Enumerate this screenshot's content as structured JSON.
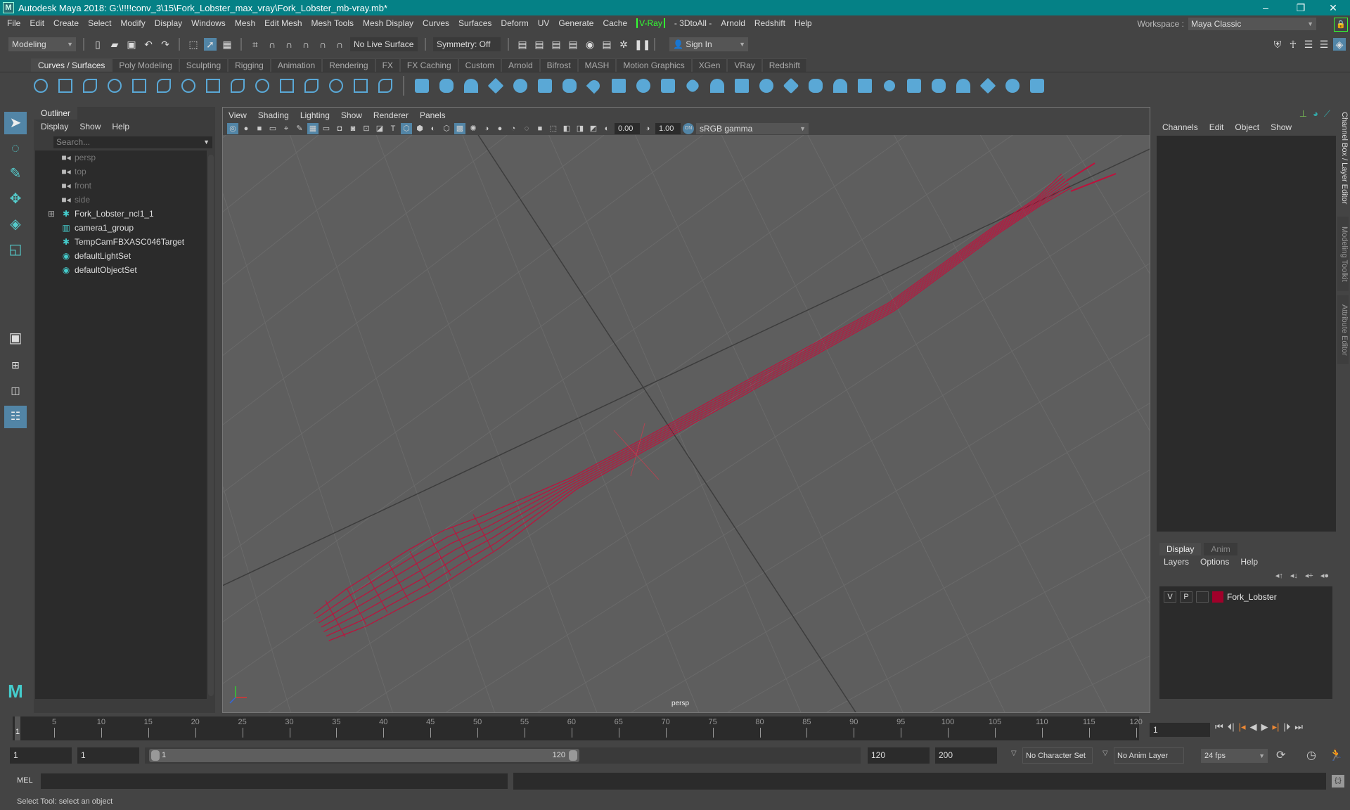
{
  "window": {
    "title": "Autodesk Maya 2018: G:\\!!!!conv_3\\15\\Fork_Lobster_max_vray\\Fork_Lobster_mb-vray.mb*",
    "minimize": "–",
    "restore": "❐",
    "close": "✕",
    "accent": "#058186"
  },
  "menubar": {
    "items": [
      "File",
      "Edit",
      "Create",
      "Select",
      "Modify",
      "Display",
      "Windows",
      "Mesh",
      "Edit Mesh",
      "Mesh Tools",
      "Mesh Display",
      "Curves",
      "Surfaces",
      "Deform",
      "UV",
      "Generate",
      "Cache"
    ],
    "vray": "V-Ray",
    "after": [
      "- 3DtoAll -",
      "Arnold",
      "Redshift",
      "Help"
    ]
  },
  "workspace": {
    "label": "Workspace :",
    "value": "Maya Classic"
  },
  "statusbar": {
    "mode": "Modeling",
    "live_surface": "No Live Surface",
    "symmetry": "Symmetry: Off",
    "sign_in": "Sign In"
  },
  "shelf": {
    "tabs": [
      "Curves / Surfaces",
      "Poly Modeling",
      "Sculpting",
      "Rigging",
      "Animation",
      "Rendering",
      "FX",
      "FX Caching",
      "Custom",
      "Arnold",
      "Bifrost",
      "MASH",
      "Motion Graphics",
      "XGen",
      "VRay",
      "Redshift"
    ],
    "active_tab": "Curves / Surfaces",
    "icon_color": "#5aa8d6",
    "icons": [
      "nurbs-circle",
      "nurbs-square",
      "ep-curve",
      "pencil-curve",
      "cv-curve",
      "bezier-curve",
      "arc",
      "curve-edit",
      "curve-fillet",
      "curve-smooth",
      "curve-offset",
      "curve-rebuild",
      "curve-split",
      "curve-insert",
      "curve-attach",
      "|",
      "nurbs-sphere",
      "nurbs-cube",
      "nurbs-cylinder",
      "nurbs-cone",
      "nurbs-plane",
      "nurbs-torus",
      "revolve",
      "loft",
      "planar",
      "extrude",
      "birail",
      "boundary",
      "square-surface",
      "bevel",
      "project-curve",
      "trim",
      "untrim",
      "intersect",
      "attach",
      "detach",
      "align",
      "open-close",
      "insert-isoparm",
      "extend",
      "sculpt",
      "rebuild"
    ]
  },
  "toolbox": [
    "select-tool",
    "lasso-tool",
    "paint-select-tool",
    "move-tool",
    "rotate-tool",
    "scale-tool"
  ],
  "outliner": {
    "tab": "Outliner",
    "menu": [
      "Display",
      "Show",
      "Help"
    ],
    "search_placeholder": "Search...",
    "items": [
      {
        "name": "persp",
        "icon": "camera-icon",
        "dim": true
      },
      {
        "name": "top",
        "icon": "camera-icon",
        "dim": true
      },
      {
        "name": "front",
        "icon": "camera-icon",
        "dim": true
      },
      {
        "name": "side",
        "icon": "camera-icon",
        "dim": true
      },
      {
        "name": "Fork_Lobster_ncl1_1",
        "icon": "transform-icon",
        "expand": "⊞"
      },
      {
        "name": "camera1_group",
        "icon": "group-icon"
      },
      {
        "name": "TempCamFBXASC046Target",
        "icon": "transform-icon"
      },
      {
        "name": "defaultLightSet",
        "icon": "set-icon"
      },
      {
        "name": "defaultObjectSet",
        "icon": "set-icon"
      }
    ]
  },
  "viewport": {
    "menu": [
      "View",
      "Shading",
      "Lighting",
      "Show",
      "Renderer",
      "Panels"
    ],
    "exposure": "0.00",
    "gamma": "1.00",
    "color_space": "sRGB gamma",
    "camera": "persp",
    "wire_color": "#c0103c",
    "bg_color": "#5e5e5e"
  },
  "channelbox": {
    "menu": [
      "Channels",
      "Edit",
      "Object",
      "Show"
    ]
  },
  "layereditor": {
    "tabs": [
      "Display",
      "Anim"
    ],
    "active_tab": "Display",
    "menu": [
      "Layers",
      "Options",
      "Help"
    ],
    "layer": {
      "v": "V",
      "p": "P",
      "name": "Fork_Lobster",
      "color": "#a0002a"
    }
  },
  "side_tabs": [
    "Channel Box / Layer Editor",
    "Modeling Toolkit",
    "Attribute Editor"
  ],
  "timeline": {
    "ticks": [
      5,
      10,
      15,
      20,
      25,
      30,
      35,
      40,
      45,
      50,
      55,
      60,
      65,
      70,
      75,
      80,
      85,
      90,
      95,
      100,
      105,
      110,
      115,
      120
    ],
    "current": "1",
    "current_field": "1"
  },
  "range": {
    "start": "1",
    "playback_start": "1",
    "slider_start": "1",
    "slider_end": "120",
    "playback_end": "120",
    "end": "200",
    "character_set": "No Character Set",
    "anim_layer": "No Anim Layer",
    "fps": "24 fps"
  },
  "command": {
    "language": "MEL"
  },
  "status": "Select Tool: select an object"
}
